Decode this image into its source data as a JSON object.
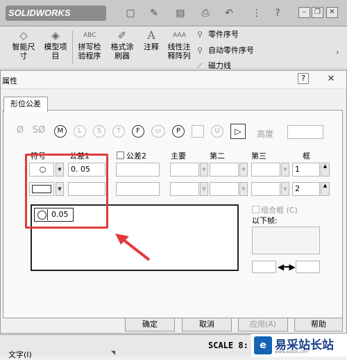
{
  "titlebar": {
    "logo": "SOLIDWORKS"
  },
  "ribbon": {
    "smart_dimension": "智能尺\n寸",
    "model_items": "模型项\n目",
    "spell_checker": "拼写检\n验程序",
    "format_painter": "格式涂\n刷器",
    "note": "注释",
    "linear_pattern": "线性注\n释阵列",
    "balloon": "零件序号",
    "auto_balloon": "自动零件序号",
    "magnetic_line": "磁力线"
  },
  "dialog": {
    "title": "属性",
    "tab": "形位公差",
    "height_label": "高度",
    "headers": {
      "symbol": "符号",
      "tolerance1": "公差1",
      "tolerance2": "公差2",
      "primary": "主要",
      "secondary": "第二",
      "tertiary": "第三",
      "frame": "框"
    },
    "row1": {
      "tolerance1": "0. 05",
      "frame": "1"
    },
    "row2": {
      "frame": "2"
    },
    "preview_tolerance": "0.05",
    "composite_frame": "组合框 (C)",
    "below_frame": "以下帧:",
    "buttons": {
      "ok": "确定",
      "cancel": "取消",
      "apply": "应用(A)",
      "help": "帮助"
    }
  },
  "bottom": {
    "property_label": "文字(I)",
    "scale_text": "SCALE 8:"
  },
  "watermark": {
    "text": "易采站长站",
    "url": "www.easck.com"
  }
}
